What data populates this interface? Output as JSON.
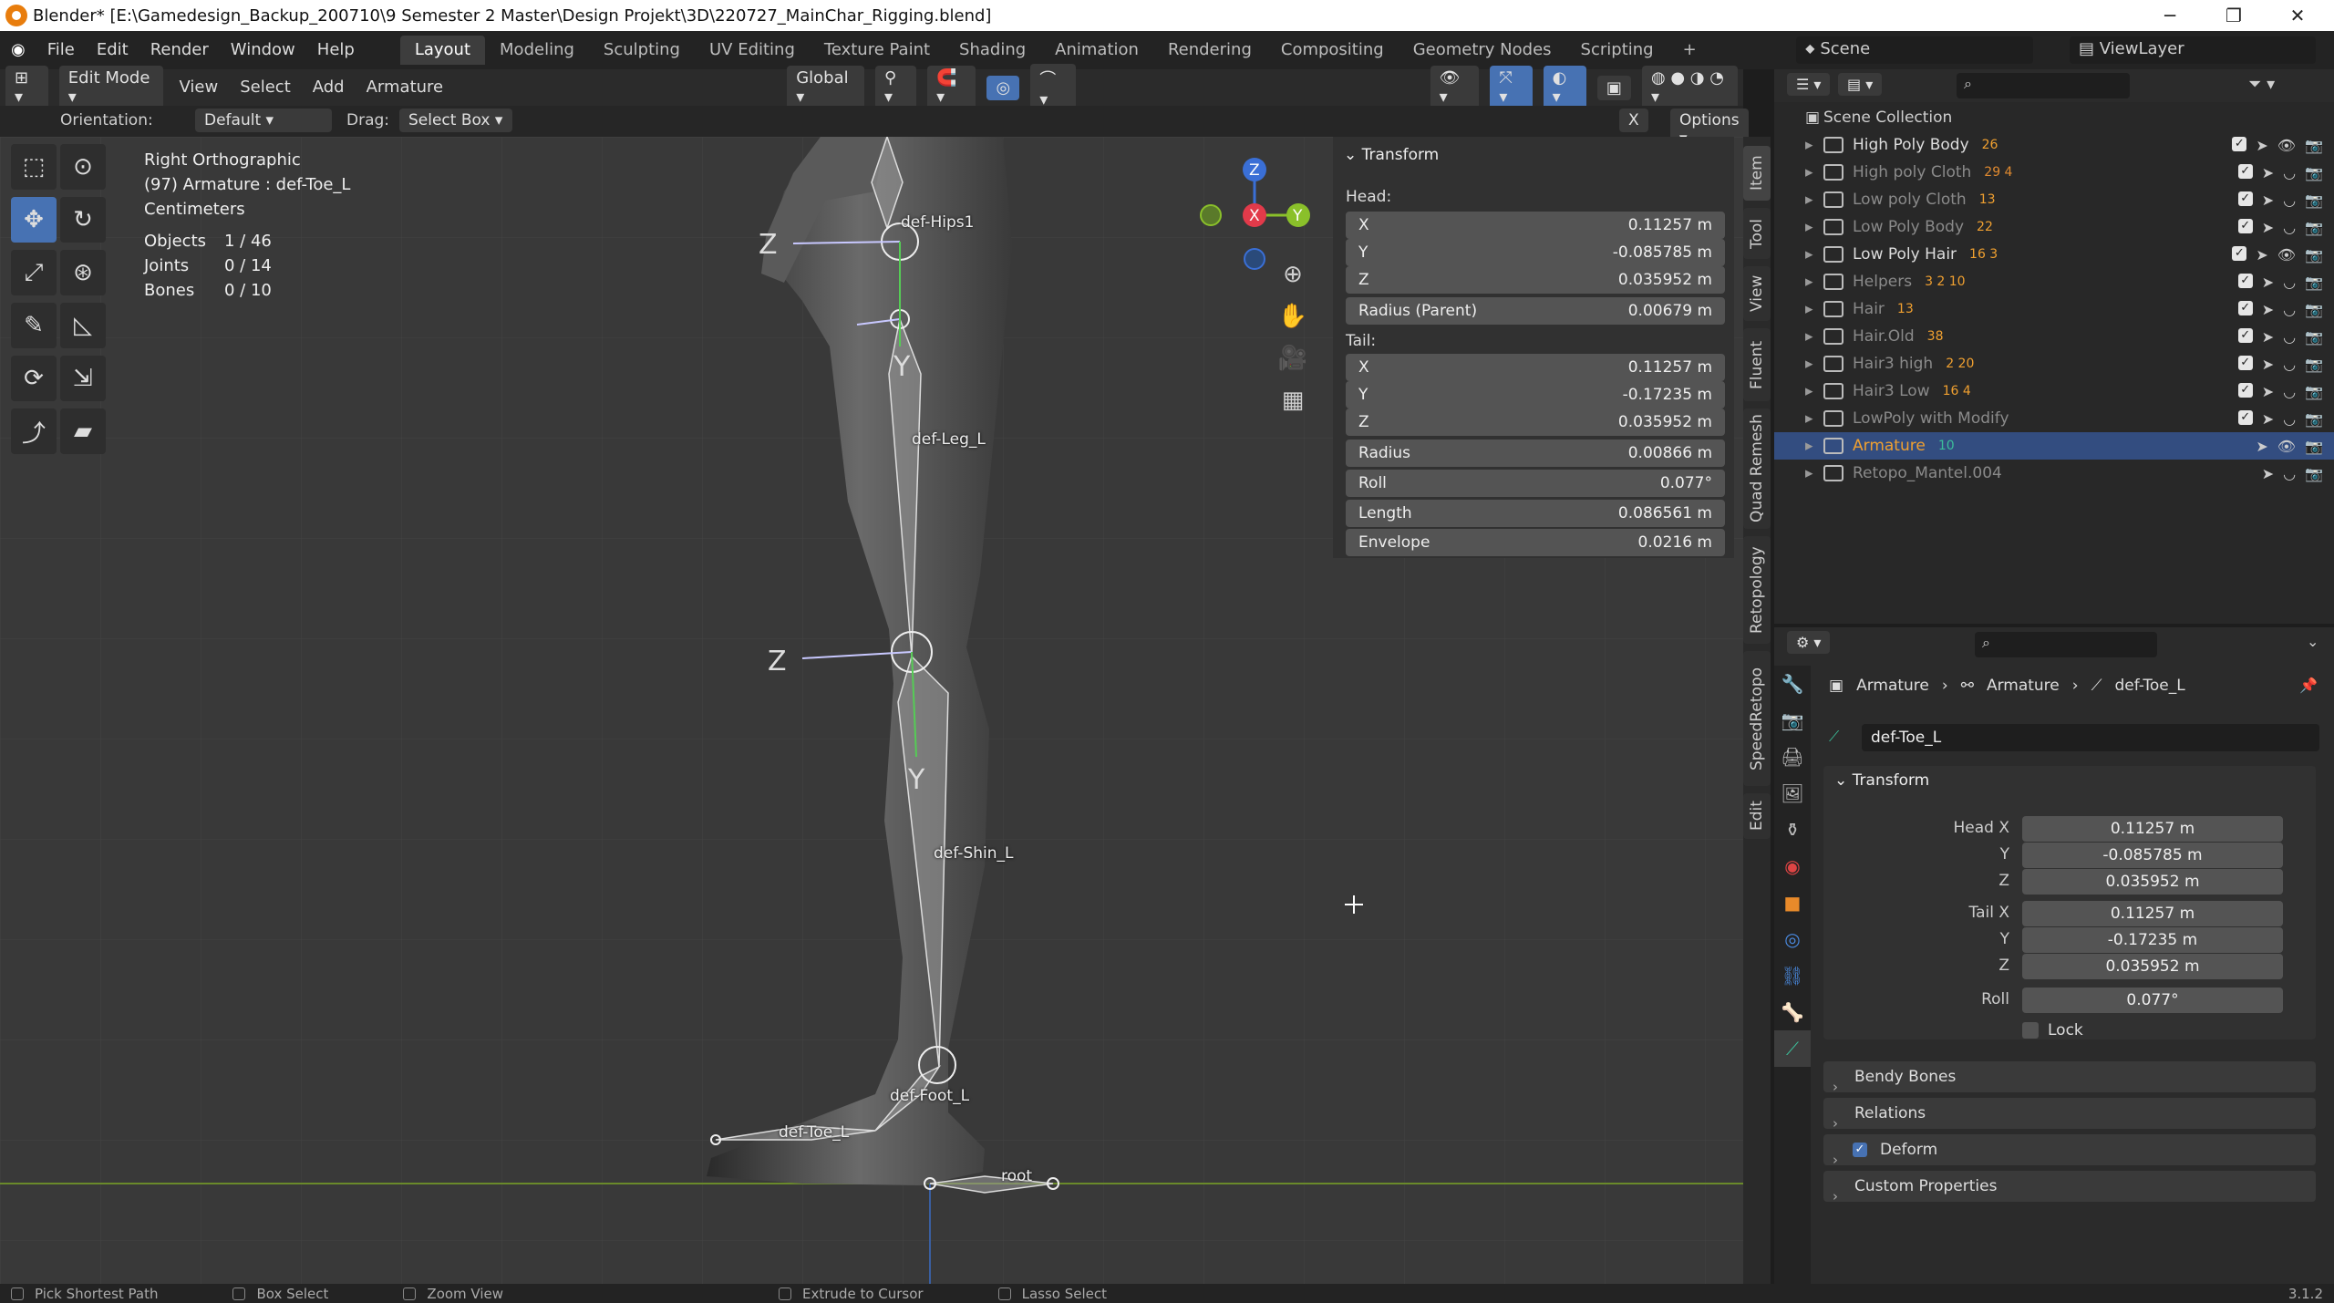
{
  "window": {
    "title": "Blender* [E:\\Gamedesign_Backup_200710\\9 Semester 2 Master\\Design Projekt\\3D\\220727_MainChar_Rigging.blend]"
  },
  "menu": [
    "File",
    "Edit",
    "Render",
    "Window",
    "Help"
  ],
  "workspaces": [
    "Layout",
    "Modeling",
    "Sculpting",
    "UV Editing",
    "Texture Paint",
    "Shading",
    "Animation",
    "Rendering",
    "Compositing",
    "Geometry Nodes",
    "Scripting"
  ],
  "scene": {
    "name": "Scene",
    "viewlayer": "ViewLayer"
  },
  "header": {
    "mode": "Edit Mode",
    "menus": [
      "View",
      "Select",
      "Add",
      "Armature"
    ],
    "transform": "Global"
  },
  "tool_header": {
    "orientation_label": "Orientation:",
    "orientation": "Default",
    "drag_label": "Drag:",
    "drag": "Select Box",
    "options": "Options"
  },
  "viewport_info": {
    "view": "Right Orthographic",
    "object": "(97) Armature : def-Toe_L",
    "units": "Centimeters",
    "objects_label": "Objects",
    "objects": "1 / 46",
    "joints_label": "Joints",
    "joints": "0 / 14",
    "bones_label": "Bones",
    "bones": "0 / 10"
  },
  "bones": {
    "hips": "def-Hips1",
    "leg": "def-Leg_L",
    "shin": "def-Shin_L",
    "foot": "def-Foot_L",
    "toe": "def-Toe_L",
    "root": "root"
  },
  "gizmo": {
    "x": "X",
    "y": "Y",
    "z": "Z"
  },
  "npanel": {
    "title": "Transform",
    "head_label": "Head:",
    "tail_label": "Tail:",
    "head": [
      {
        "k": "X",
        "v": "0.11257 m"
      },
      {
        "k": "Y",
        "v": "-0.085785 m"
      },
      {
        "k": "Z",
        "v": "0.035952 m"
      },
      {
        "k": "Radius (Parent)",
        "v": "0.00679 m"
      }
    ],
    "tail": [
      {
        "k": "X",
        "v": "0.11257 m"
      },
      {
        "k": "Y",
        "v": "-0.17235 m"
      },
      {
        "k": "Z",
        "v": "0.035952 m"
      },
      {
        "k": "Radius",
        "v": "0.00866 m"
      },
      {
        "k": "Roll",
        "v": "0.077°"
      },
      {
        "k": "Length",
        "v": "0.086561 m"
      },
      {
        "k": "Envelope",
        "v": "0.0216 m"
      }
    ]
  },
  "vtabs": [
    "Item",
    "Tool",
    "View",
    "Fluent",
    "Quad Remesh",
    "Retopology",
    "SpeedRetopo",
    "Edit"
  ],
  "outliner": {
    "root": "Scene Collection",
    "items": [
      {
        "name": "High Poly Body",
        "badge": "26"
      },
      {
        "name": "High poly Cloth",
        "badge": "29 4"
      },
      {
        "name": "Low poly Cloth",
        "badge": "13"
      },
      {
        "name": "Low Poly Body",
        "badge": "22"
      },
      {
        "name": "Low Poly Hair",
        "badge": "16 3"
      },
      {
        "name": "Helpers",
        "badge": "3 2 10"
      },
      {
        "name": "Hair",
        "badge": "13"
      },
      {
        "name": "Hair.Old",
        "badge": "38"
      },
      {
        "name": "Hair3 high",
        "badge": "2 20"
      },
      {
        "name": "Hair3 Low",
        "badge": "16 4"
      },
      {
        "name": "LowPoly with Modify",
        "badge": ""
      },
      {
        "name": "Armature",
        "badge": "10"
      },
      {
        "name": "Retopo_Mantel.004",
        "badge": ""
      }
    ]
  },
  "properties": {
    "breadcrumb": [
      "Armature",
      "Armature",
      "def-Toe_L"
    ],
    "bone_name": "def-Toe_L",
    "section": "Transform",
    "head_x_label": "Head X",
    "head_x": "0.11257 m",
    "head_y_label": "Y",
    "head_y": "-0.085785 m",
    "head_z_label": "Z",
    "head_z": "0.035952 m",
    "tail_x_label": "Tail X",
    "tail_x": "0.11257 m",
    "tail_y_label": "Y",
    "tail_y": "-0.17235 m",
    "tail_z_label": "Z",
    "tail_z": "0.035952 m",
    "roll_label": "Roll",
    "roll": "0.077°",
    "lock": "Lock",
    "sections": [
      "Bendy Bones",
      "Relations",
      "Deform",
      "Custom Properties"
    ]
  },
  "status": [
    "Pick Shortest Path",
    "Box Select",
    "Zoom View",
    "Extrude to Cursor",
    "Lasso Select"
  ],
  "version": "3.1.2"
}
